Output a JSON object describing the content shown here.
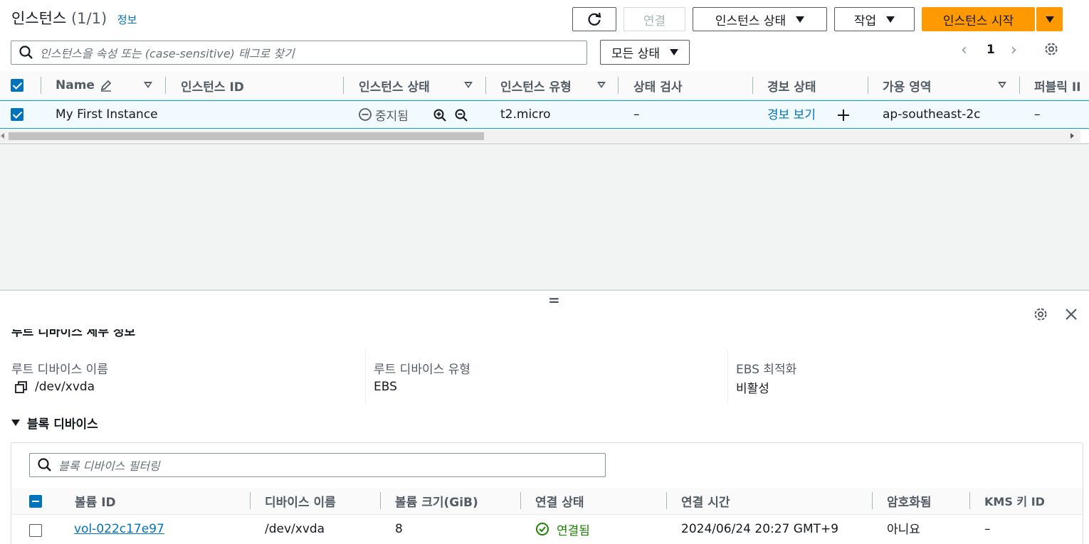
{
  "header": {
    "title": "인스턴스",
    "count": "(1/1)",
    "info_link": "정보"
  },
  "toolbar": {
    "connect_label": "연결",
    "instance_state_label": "인스턴스 상태",
    "actions_label": "작업",
    "launch_label": "인스턴스 시작"
  },
  "search": {
    "placeholder": "인스턴스을 속성 또는 (case-sensitive) 태그로 찾기"
  },
  "state_filter": {
    "label": "모든 상태"
  },
  "pagination": {
    "current_page": "1"
  },
  "instances_table": {
    "columns": [
      "Name",
      "인스턴스 ID",
      "인스턴스 상태",
      "인스턴스 유형",
      "상태 검사",
      "경보 상태",
      "가용 영역",
      "퍼블릭 IP"
    ],
    "rows": [
      {
        "name": "My First Instance",
        "instance_id": "",
        "state": "중지됨",
        "type": "t2.micro",
        "status_check": "–",
        "alarm": "경보 보기",
        "az": "ap-southeast-2c",
        "public_ip": "–"
      }
    ]
  },
  "splitter": {
    "handle": "="
  },
  "detail": {
    "section_title_partial": "루트 디바이스 세부 정보",
    "root_device_name_label": "루트 디바이스 이름",
    "root_device_name_value": "/dev/xvda",
    "root_device_type_label": "루트 디바이스 유형",
    "root_device_type_value": "EBS",
    "ebs_optimized_label": "EBS 최적화",
    "ebs_optimized_value": "비활성"
  },
  "block_devices": {
    "title": "블록 디바이스",
    "filter_placeholder": "블록 디바이스 필터링",
    "columns": [
      "볼륨 ID",
      "디바이스 이름",
      "볼륨 크기(GiB)",
      "연결 상태",
      "연결 시간",
      "암호화됨",
      "KMS 키 ID"
    ],
    "rows": [
      {
        "volume_id": "vol-022c17e97",
        "device_name": "/dev/xvda",
        "size": "8",
        "attach_state": "연결됨",
        "attach_time": "2024/06/24 20:27 GMT+9",
        "encrypted": "아니요",
        "kms_key": "–"
      }
    ]
  },
  "colors": {
    "accent": "#0073bb",
    "launch_button": "#ff9900",
    "success": "#1d8102",
    "selected_row": "#f1faff"
  }
}
